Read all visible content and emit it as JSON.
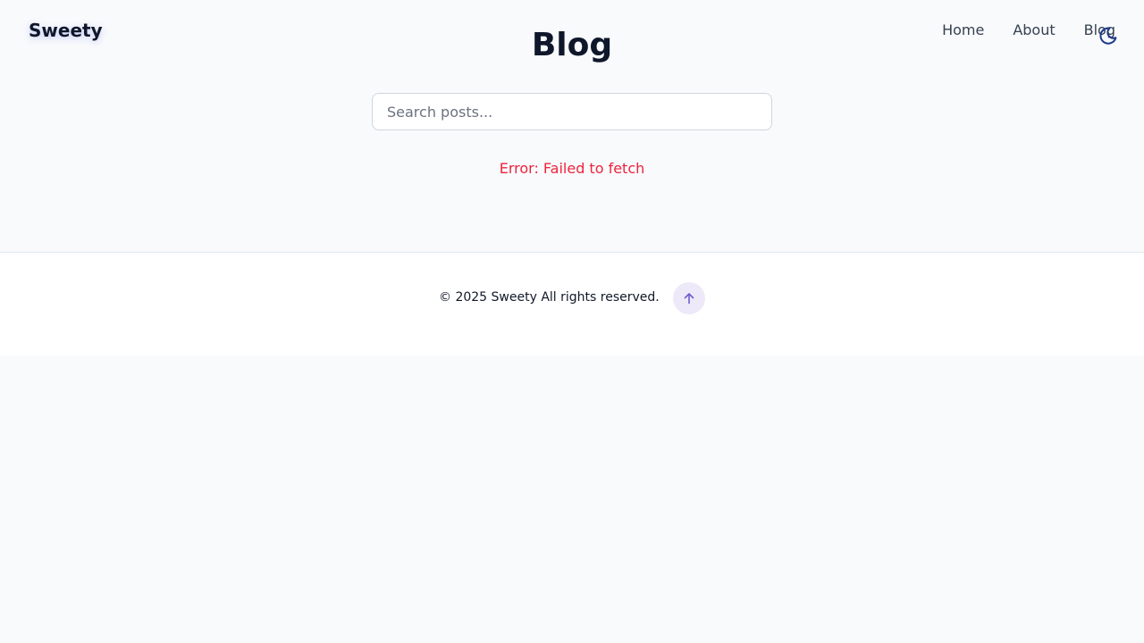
{
  "brand": {
    "name": "Sweety"
  },
  "nav": {
    "items": [
      {
        "label": "Home"
      },
      {
        "label": "About"
      },
      {
        "label": "Blog"
      }
    ],
    "theme_toggle_icon": "moon-icon"
  },
  "main": {
    "title": "Blog",
    "search": {
      "placeholder": "Search posts...",
      "value": ""
    },
    "error_message": "Error: Failed to fetch"
  },
  "footer": {
    "copyright": "© 2025 Sweety All rights reserved.",
    "back_to_top_icon": "arrow-up-icon"
  },
  "colors": {
    "background": "#f8fafc",
    "text": "#0f172a",
    "error": "#ef233c",
    "accent": "#6d5fcf",
    "back_to_top_bg": "#ede9f8",
    "toggle": "#1e3a8a"
  }
}
